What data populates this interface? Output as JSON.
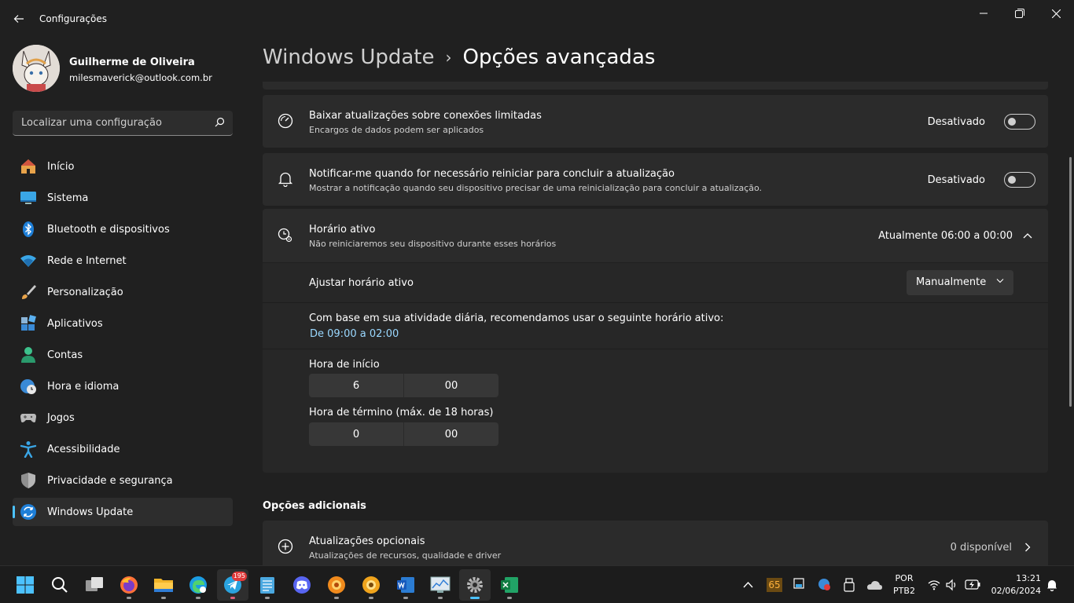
{
  "window": {
    "app_title": "Configurações"
  },
  "profile": {
    "name": "Guilherme de Oliveira",
    "email": "milesmaverick@outlook.com.br"
  },
  "search": {
    "placeholder": "Localizar uma configuração"
  },
  "sidebar": {
    "items": [
      {
        "label": "Início",
        "icon": "home-icon"
      },
      {
        "label": "Sistema",
        "icon": "system-icon"
      },
      {
        "label": "Bluetooth e dispositivos",
        "icon": "bluetooth-icon"
      },
      {
        "label": "Rede e Internet",
        "icon": "wifi-icon"
      },
      {
        "label": "Personalização",
        "icon": "brush-icon"
      },
      {
        "label": "Aplicativos",
        "icon": "apps-icon"
      },
      {
        "label": "Contas",
        "icon": "account-icon"
      },
      {
        "label": "Hora e idioma",
        "icon": "clock-globe-icon"
      },
      {
        "label": "Jogos",
        "icon": "gamepad-icon"
      },
      {
        "label": "Acessibilidade",
        "icon": "accessibility-icon"
      },
      {
        "label": "Privacidade e segurança",
        "icon": "shield-icon"
      },
      {
        "label": "Windows Update",
        "icon": "update-icon",
        "active": true
      }
    ]
  },
  "header": {
    "parent": "Windows Update",
    "separator": "›",
    "current": "Opções avançadas"
  },
  "settings": {
    "metered": {
      "title": "Baixar atualizações sobre conexões limitadas",
      "description": "Encargos de dados podem ser aplicados",
      "state_label": "Desativado",
      "on": false
    },
    "notify_restart": {
      "title": "Notificar-me quando for necessário reiniciar para concluir a atualização",
      "description": "Mostrar a notificação quando seu dispositivo precisar de uma reinicialização para concluir a atualização.",
      "state_label": "Desativado",
      "on": false
    },
    "active_hours": {
      "title": "Horário ativo",
      "description": "Não reiniciaremos seu dispositivo durante esses horários",
      "current": "Atualmente 06:00 a 00:00",
      "adjust_label": "Ajustar horário ativo",
      "adjust_value": "Manualmente",
      "recommendation_text": "Com base em sua atividade diária, recomendamos usar o seguinte horário ativo:",
      "recommendation_link": "De 09:00 a 02:00",
      "start_label": "Hora de início",
      "start_hour": "6",
      "start_minute": "00",
      "end_label": "Hora de término (máx. de 18 horas)",
      "end_hour": "0",
      "end_minute": "00"
    }
  },
  "additional": {
    "section_title": "Opções adicionais",
    "optional_updates": {
      "title": "Atualizações opcionais",
      "description": "Atualizações de recursos, qualidade e driver",
      "count": "0 disponível"
    }
  },
  "taskbar": {
    "telegram_badge": "195",
    "tray_number": "65",
    "language": "POR",
    "layout": "PTB2",
    "time": "13:21",
    "date": "02/06/2024"
  },
  "colors": {
    "accent": "#4cc2ff",
    "background": "#202020",
    "card": "#2b2b2b"
  }
}
